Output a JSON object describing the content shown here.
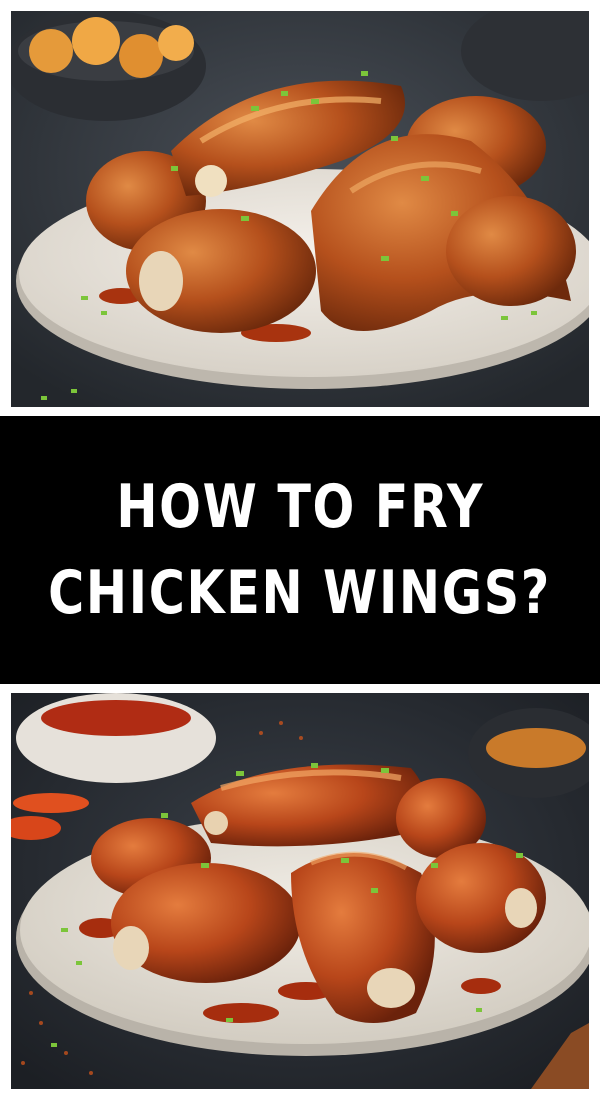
{
  "pin": {
    "title_lines": [
      "HOW TO FRY",
      "CHICKEN WINGS?"
    ],
    "colors": {
      "background": "#ffffff",
      "title_band": "#000000",
      "title_text": "#ffffff",
      "glaze": "#b5501c",
      "chive": "#7cc53a"
    },
    "top_photo": {
      "subject": "glazed fried chicken wings on white plate with chopped chives"
    },
    "bottom_photo": {
      "subject": "saucy chicken wings on plate with chili flakes and dipping sauce"
    }
  }
}
